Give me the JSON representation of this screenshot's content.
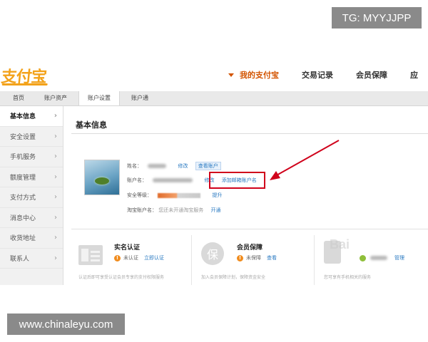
{
  "overlay": {
    "tg_badge": "TG: MYYJJPP",
    "site_badge": "www.chinaleyu.com"
  },
  "header": {
    "logo": "支付宝",
    "nav": [
      {
        "label": "我的支付宝",
        "active": true
      },
      {
        "label": "交易记录"
      },
      {
        "label": "会员保障"
      },
      {
        "label": "应"
      }
    ]
  },
  "subnav": [
    "首页",
    "账户资产",
    "账户设置",
    "账户通"
  ],
  "sidebar": [
    {
      "label": "基本信息",
      "active": true
    },
    {
      "label": "安全设置"
    },
    {
      "label": "手机服务"
    },
    {
      "label": "额度管理"
    },
    {
      "label": "支付方式"
    },
    {
      "label": "消息中心"
    },
    {
      "label": "收货地址"
    },
    {
      "label": "联系人"
    }
  ],
  "main": {
    "section_title": "基本信息",
    "name_label": "姓名：",
    "name_edit": "修改",
    "bind_account": "查看账户",
    "account_label": "账户名：",
    "account_edit": "修改",
    "add_email": "添加邮箱账户名",
    "security_label": "安全等级：",
    "security_link": "提升",
    "taobao_label": "淘宝账户名：",
    "taobao_text": "您还未开通淘宝服务",
    "taobao_link": "开通"
  },
  "cards": [
    {
      "title": "实名认证",
      "status": "未认证",
      "action": "立即认证",
      "desc": "认证后即可享受认证会员专享的支付权限服务",
      "icon": "id-card-icon"
    },
    {
      "title": "会员保障",
      "status": "未保障",
      "action": "查看",
      "desc": "加入会员保障计划，保障资金安全",
      "icon": "shield-icon"
    },
    {
      "title": "",
      "status": "",
      "action": "管理",
      "desc": "您可享有手机相关的服务",
      "icon": "phone-icon"
    }
  ],
  "watermark": "Bai",
  "colors": {
    "logo": "#f3a21a",
    "active_nav": "#d35400",
    "highlight": "#d0021b",
    "link": "#2a7ac2"
  }
}
